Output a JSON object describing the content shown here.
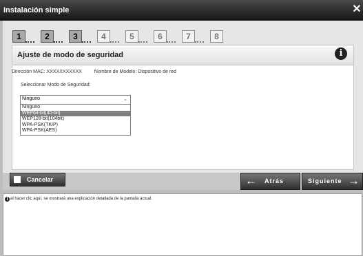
{
  "window": {
    "title": "Instalación simple",
    "close_symbol": "✕"
  },
  "steps": [
    "1",
    "2",
    "3",
    "4",
    "5",
    "6",
    "7",
    "8"
  ],
  "card": {
    "heading": "Ajuste de modo de seguridad",
    "mac_label": "Dirección MAC: XXXXXXXXXXX",
    "model_label": "Nombre de Modelo: Dispositivo de red",
    "security_label": "Seleccionar Modo de Seguridad:"
  },
  "select": {
    "value": "Ninguno",
    "options": [
      "Ninguno",
      "WEP64-bit(40-bit)",
      "WEP128-bit(104bit)",
      "WPA-PSK(TKIP)",
      "WPA-PSK(AES)"
    ],
    "highlighted_option": "WEP64-bit(40-bit)"
  },
  "nav": {
    "cancel": "Cancelar",
    "back": "Atrás",
    "next": "Siguiente"
  },
  "help": {
    "text": "al hacer clic aquí, se mostrará una explicación detallada de la pantalla actual."
  },
  "colors": {
    "titlebar": "#141414",
    "selected_option": "#7f7f7f",
    "panel": "#e6e6e6"
  }
}
